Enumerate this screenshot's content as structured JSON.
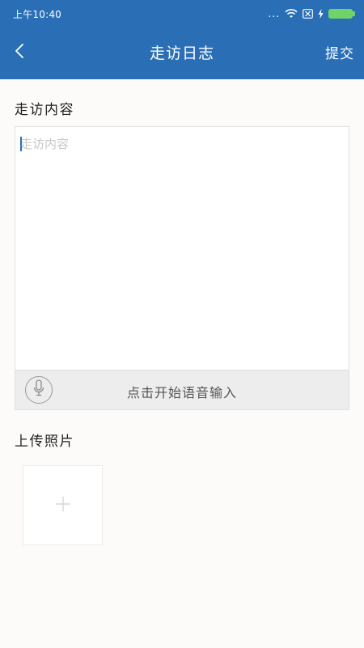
{
  "status_bar": {
    "time": "上午10:40",
    "dots": "..."
  },
  "nav": {
    "title": "走访日志",
    "submit_label": "提交"
  },
  "content": {
    "label": "走访内容",
    "placeholder": "走访内容",
    "value": ""
  },
  "voice": {
    "label": "点击开始语音输入"
  },
  "photos": {
    "label": "上传照片"
  },
  "colors": {
    "header_bg": "#2a6fb6",
    "page_bg": "#fcfbf9",
    "voice_bar_bg": "#ededed",
    "battery": "#6fd36a"
  },
  "icons": {
    "back": "chevron-left-icon",
    "mic": "microphone-icon",
    "add_photo": "plus-icon",
    "wifi": "wifi-icon",
    "sim": "sim-no-signal-icon",
    "charging": "charging-bolt-icon",
    "battery": "battery-icon"
  }
}
